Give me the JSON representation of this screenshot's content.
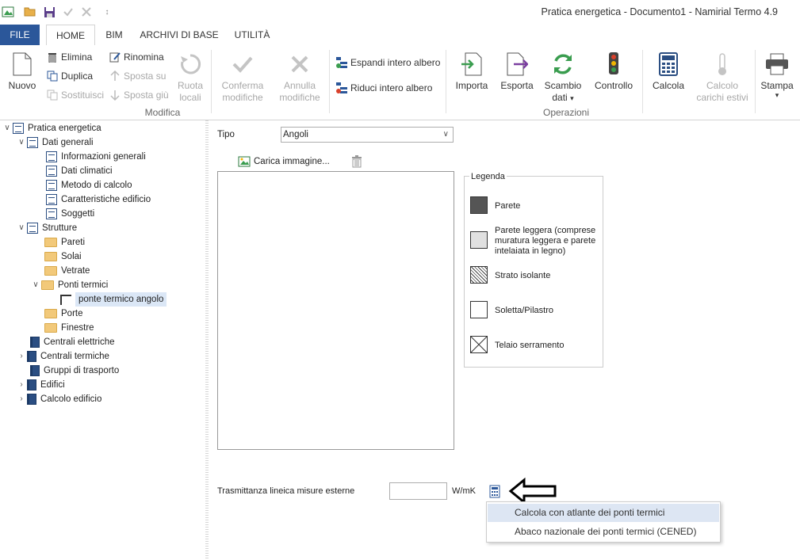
{
  "window": {
    "title": "Pratica energetica - Documento1 - Namirial Termo 4.9"
  },
  "qat": {
    "icons": [
      "app-icon",
      "open-folder-icon",
      "save-icon",
      "check-icon",
      "close-icon",
      "customize-icon"
    ],
    "customize_glyph": "↕"
  },
  "tabs": {
    "file": "FILE",
    "home": "HOME",
    "bim": "BIM",
    "archivi": "ARCHIVI DI BASE",
    "utilita": "UTILITÀ"
  },
  "ribbon": {
    "modifica": {
      "group_label": "Modifica",
      "nuovo": "Nuovo",
      "elimina": "Elimina",
      "duplica": "Duplica",
      "sostituisci": "Sostituisci",
      "rinomina": "Rinomina",
      "sposta_su": "Sposta su",
      "sposta_giu": "Sposta giù",
      "ruota_1": "Ruota",
      "ruota_2": "locali",
      "conferma_1": "Conferma",
      "conferma_2": "modifiche",
      "annulla_1": "Annulla",
      "annulla_2": "modifiche"
    },
    "albero": {
      "espandi": "Espandi intero albero",
      "riduci": "Riduci intero albero"
    },
    "operazioni": {
      "group_label": "Operazioni",
      "importa": "Importa",
      "esporta": "Esporta",
      "scambio_1": "Scambio",
      "scambio_2": "dati",
      "controllo": "Controllo"
    },
    "calcola": "Calcola",
    "carichi_1": "Calcolo",
    "carichi_2": "carichi estivi",
    "stampa": "Stampa",
    "dropdown_glyph": "▾"
  },
  "tree": {
    "root": "Pratica energetica",
    "dati_generali": "Dati generali",
    "informazioni": "Informazioni generali",
    "dati_climatici": "Dati climatici",
    "metodo": "Metodo di calcolo",
    "caratteristiche": "Caratteristiche edificio",
    "soggetti": "Soggetti",
    "strutture": "Strutture",
    "pareti": "Pareti",
    "solai": "Solai",
    "vetrate": "Vetrate",
    "ponti": "Ponti termici",
    "ponte_angolo": "ponte termico angolo",
    "porte": "Porte",
    "finestre": "Finestre",
    "centrali_elettriche": "Centrali elettriche",
    "centrali_termiche": "Centrali termiche",
    "gruppi": "Gruppi di trasporto",
    "edifici": "Edifici",
    "calcolo_edificio": "Calcolo edificio",
    "expanded_glyph": "∨",
    "collapsed_glyph": "›"
  },
  "form": {
    "tipo_label": "Tipo",
    "tipo_value": "Angoli",
    "select_glyph": "∨",
    "carica": "Carica immagine...",
    "trasm_label": "Trasmittanza lineica misure esterne",
    "trasm_value": "",
    "unit": "W/mK"
  },
  "legend": {
    "title": "Legenda",
    "parete": "Parete",
    "leggera_1": "Parete leggera (comprese",
    "leggera_2": "muratura leggera e parete",
    "leggera_3": "intelaiata in legno)",
    "isolante": "Strato isolante",
    "soletta": "Soletta/Pilastro",
    "telaio": "Telaio serramento"
  },
  "menu": {
    "item1": "Calcola con atlante dei ponti termici",
    "item2": "Abaco nazionale dei ponti termici (CENED)"
  },
  "colors": {
    "accent": "#2b579a",
    "menu_highlight": "#dde6f3",
    "tree_selected": "#dbe7f6",
    "folder": "#f2c97a"
  }
}
